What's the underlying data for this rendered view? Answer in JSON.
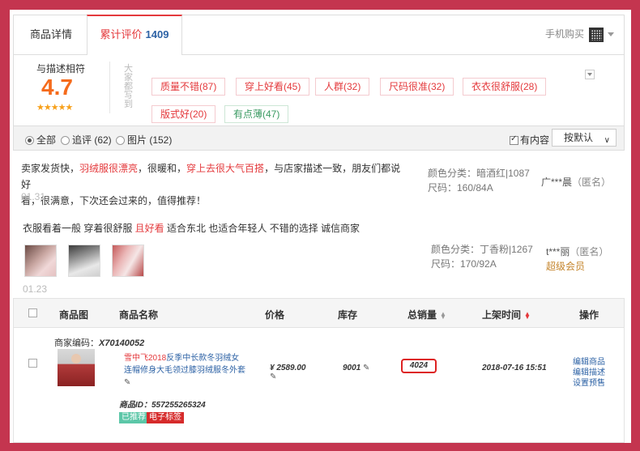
{
  "tabs": {
    "details": "商品详情",
    "reviews": "累计评价",
    "reviews_count": "1409",
    "mobile_buy": "手机购买"
  },
  "summary": {
    "label": "与描述相符",
    "score": "4.7",
    "stars": "★★★★★",
    "vertical_label": "大家都写到",
    "tags": [
      "质量不错(87)",
      "穿上好看(45)",
      "人群(32)",
      "尺码很准(32)",
      "衣衣很舒服(28)",
      "版式好(20)",
      "有点薄(47)"
    ]
  },
  "filters": {
    "all": "全部",
    "followup": "追评 (62)",
    "images": "图片 (152)",
    "has_content": "有内容",
    "sort": "按默认"
  },
  "reviews": [
    {
      "text_a": "卖家发货快，",
      "text_hl1": "羽绒服很漂亮",
      "text_b": "，很暖和，",
      "text_hl2": "穿上去很大气百搭",
      "text_c": "，与店家描述一致，朋友们都说好",
      "text_d": "看，很满意，下次还会过来的，值得推荐！",
      "date": "01.31",
      "color": "颜色分类：暗酒红|1087",
      "size": "尺码：160/84A",
      "user": "广***晨",
      "anon": "（匿名）"
    },
    {
      "text_a": "衣服看着一般 穿着很舒服 ",
      "text_hl1": "且好看",
      "text_b": " 适合东北 也适合年轻人 不错的选择 诚信商家",
      "date": "01.23",
      "color": "颜色分类：丁香粉|1267",
      "size": "尺码：170/92A",
      "user": "t***丽",
      "anon": "（匿名）",
      "vip": "超级会员"
    }
  ],
  "table": {
    "headers": {
      "image": "商品图",
      "name": "商品名称",
      "price": "价格",
      "stock": "库存",
      "sales": "总销量",
      "time": "上架时间",
      "ops": "操作"
    },
    "row": {
      "code_label": "商家编码：",
      "code": "X70140052",
      "name_hl": "雪中飞2018",
      "name_rest": "反季中长款冬羽绒女连帽修身大毛领过膝羽绒服冬外套",
      "pid_label": "商品ID：",
      "pid": "557255265324",
      "badge1": "已推荐",
      "badge2": "电子标签",
      "price": "¥ 2589.00",
      "stock": "9001",
      "sales": "4024",
      "time": "2018-07-16 15:51",
      "op1": "编辑商品",
      "op2": "编辑描述",
      "op3": "设置预售"
    }
  },
  "colors": {
    "accent": "#e4393c",
    "link": "#2d62a5",
    "score": "#f56b1c",
    "frame": "#c4354f"
  }
}
